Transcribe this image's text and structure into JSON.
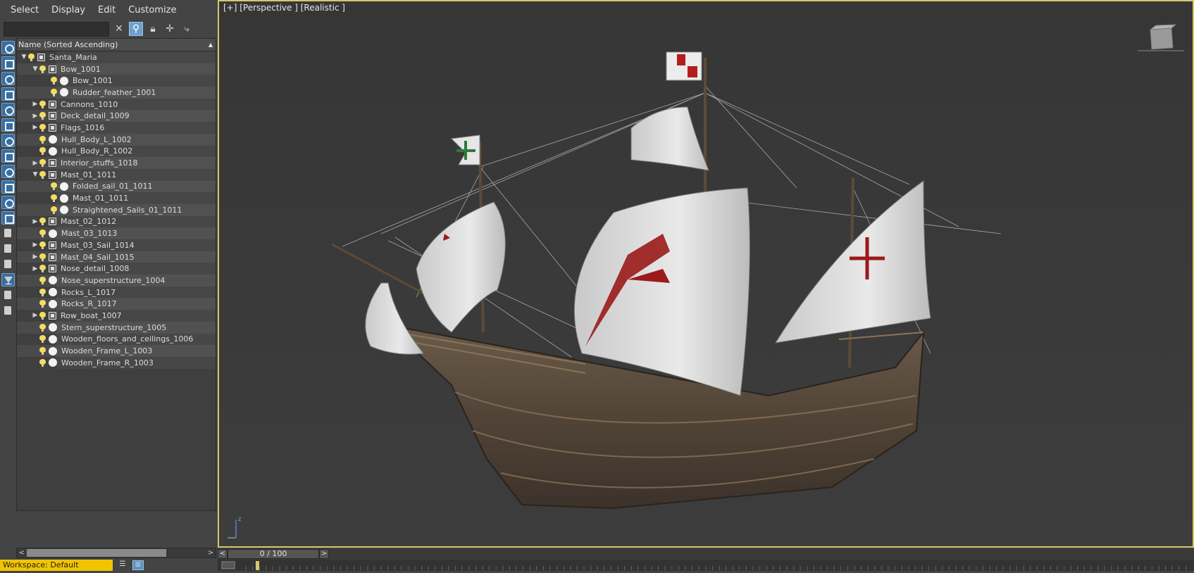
{
  "menu": [
    "Select",
    "Display",
    "Edit",
    "Customize"
  ],
  "search": {
    "value": ""
  },
  "column_header": "Name (Sorted Ascending)",
  "tree": [
    {
      "label": "Santa_Maria",
      "depth": 0,
      "toggle": "expanded",
      "icon": "group"
    },
    {
      "label": "Bow_1001",
      "depth": 1,
      "toggle": "expanded",
      "icon": "group"
    },
    {
      "label": "Bow_1001",
      "depth": 2,
      "toggle": "none",
      "icon": "mesh"
    },
    {
      "label": "Rudder_feather_1001",
      "depth": 2,
      "toggle": "none",
      "icon": "mesh"
    },
    {
      "label": "Cannons_1010",
      "depth": 1,
      "toggle": "collapsed",
      "icon": "group"
    },
    {
      "label": "Deck_detail_1009",
      "depth": 1,
      "toggle": "collapsed",
      "icon": "group"
    },
    {
      "label": "Flags_1016",
      "depth": 1,
      "toggle": "collapsed",
      "icon": "group"
    },
    {
      "label": "Hull_Body_L_1002",
      "depth": 1,
      "toggle": "none",
      "icon": "mesh"
    },
    {
      "label": "Hull_Body_R_1002",
      "depth": 1,
      "toggle": "none",
      "icon": "mesh"
    },
    {
      "label": "Interior_stuffs_1018",
      "depth": 1,
      "toggle": "collapsed",
      "icon": "group"
    },
    {
      "label": "Mast_01_1011",
      "depth": 1,
      "toggle": "expanded",
      "icon": "group"
    },
    {
      "label": "Folded_sail_01_1011",
      "depth": 2,
      "toggle": "none",
      "icon": "mesh"
    },
    {
      "label": "Mast_01_1011",
      "depth": 2,
      "toggle": "none",
      "icon": "mesh"
    },
    {
      "label": "Straightened_Sails_01_1011",
      "depth": 2,
      "toggle": "none",
      "icon": "mesh"
    },
    {
      "label": "Mast_02_1012",
      "depth": 1,
      "toggle": "collapsed",
      "icon": "group"
    },
    {
      "label": "Mast_03_1013",
      "depth": 1,
      "toggle": "none",
      "icon": "mesh"
    },
    {
      "label": "Mast_03_Sail_1014",
      "depth": 1,
      "toggle": "collapsed",
      "icon": "group"
    },
    {
      "label": "Mast_04_Sail_1015",
      "depth": 1,
      "toggle": "collapsed",
      "icon": "group"
    },
    {
      "label": "Nose_detail_1008",
      "depth": 1,
      "toggle": "collapsed",
      "icon": "group"
    },
    {
      "label": "Nose_superstructure_1004",
      "depth": 1,
      "toggle": "none",
      "icon": "mesh"
    },
    {
      "label": "Rocks_L_1017",
      "depth": 1,
      "toggle": "none",
      "icon": "mesh"
    },
    {
      "label": "Rocks_R_1017",
      "depth": 1,
      "toggle": "none",
      "icon": "mesh"
    },
    {
      "label": "Row_boat_1007",
      "depth": 1,
      "toggle": "collapsed",
      "icon": "group"
    },
    {
      "label": "Stern_superstructure_1005",
      "depth": 1,
      "toggle": "none",
      "icon": "mesh"
    },
    {
      "label": "Wooden_floors_and_ceilings_1006",
      "depth": 1,
      "toggle": "none",
      "icon": "mesh"
    },
    {
      "label": "Wooden_Frame_L_1003",
      "depth": 1,
      "toggle": "none",
      "icon": "mesh"
    },
    {
      "label": "Wooden_Frame_R_1003",
      "depth": 1,
      "toggle": "none",
      "icon": "mesh"
    }
  ],
  "viewport": {
    "label": "[+] [Perspective ] [Realistic ]",
    "axis_z": "z"
  },
  "timeline": {
    "frame": "0 / 100"
  },
  "status": {
    "workspace": "Workspace: Default"
  },
  "colors": {
    "accent": "#d7c66b",
    "workspace_bg": "#f2c400",
    "selection_blue": "#6da0cc"
  }
}
